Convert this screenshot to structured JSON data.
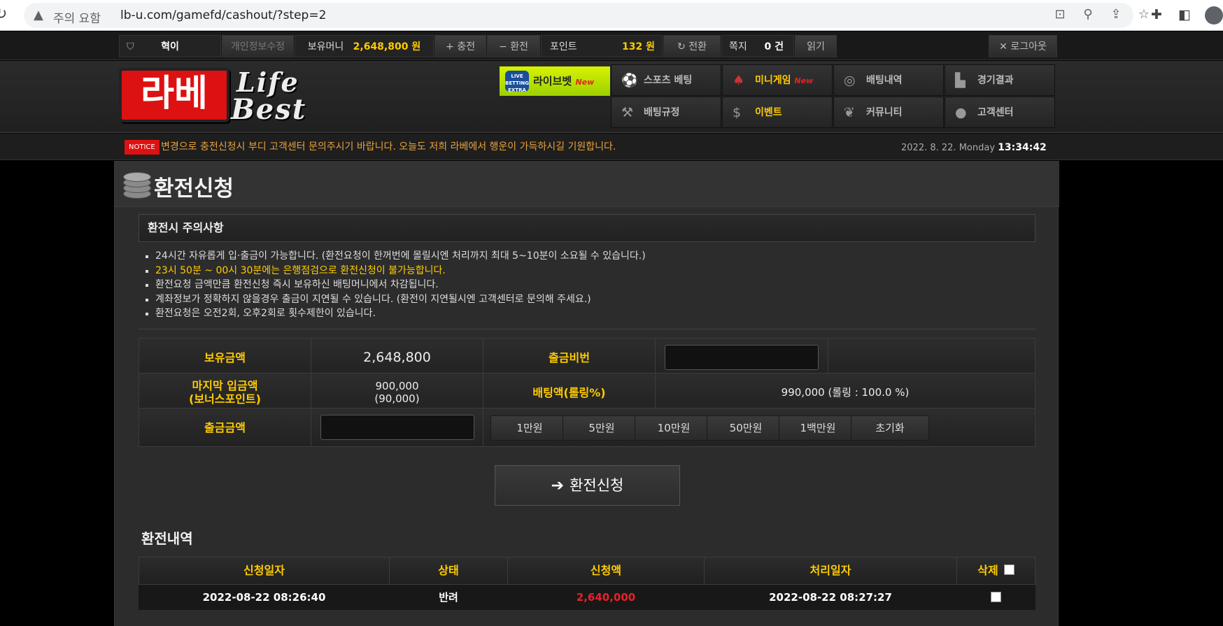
{
  "browser": {
    "security_label": "주의 요함",
    "url": "lb-u.com/gamefd/cashout/?step=2"
  },
  "userbar": {
    "username": "혁이",
    "edit_profile": "개인정보수정",
    "money_label": "보유머니",
    "money_value": "2,648,800 원",
    "charge": "+ 충전",
    "exchange": "− 환전",
    "point_label": "포인트",
    "point_value": "132 원",
    "convert": "↻ 전환",
    "memo_label": "쪽지",
    "memo_value": "0 건",
    "read": "읽기",
    "logout": "✕ 로그아웃"
  },
  "header": {
    "logo_kr": "라베",
    "logo_en_1": "Life",
    "logo_en_2": "Best",
    "live_badge": "LIVE BETTING EXTRA",
    "live_label": "라이브벳",
    "live_new": "New",
    "nav": [
      {
        "label": "스포츠 베팅",
        "icon": "soccer-ball-icon"
      },
      {
        "label": "미니게임",
        "icon": "cards-icon",
        "new": "New"
      },
      {
        "label": "배팅내역",
        "icon": "target-icon"
      },
      {
        "label": "경기결과",
        "icon": "podium-icon"
      },
      {
        "label": "배팅규정",
        "icon": "gavel-icon"
      },
      {
        "label": "이벤트",
        "icon": "money-bag-icon"
      },
      {
        "label": "커뮤니티",
        "icon": "community-icon"
      },
      {
        "label": "고객센터",
        "icon": "apple-icon"
      }
    ]
  },
  "notice": {
    "tag": "NOTICE",
    "text": "변경으로 충전신청시 부디 고객센터 문의주시기 바랍니다. 오늘도 저희 라베에서 행운이 가득하시길 기원합니다.",
    "date": "2022. 8. 22. Monday",
    "time": "13:34:42"
  },
  "page": {
    "title": "환전신청",
    "caution_title": "환전시 주의사항",
    "cautions": [
      "24시간 자유롭게 입·출금이 가능합니다. (환전요청이 한꺼번에 몰릴시엔 처리까지 최대 5~10분이 소요될 수 있습니다.)",
      "23시 50분 ~ 00시 30분에는 은행점검으로 환전신청이 불가능합니다.",
      "환전요청 금액만큼 환전신청 즉시 보유하신 배팅머니에서 차감됩니다.",
      "계좌정보가 정확하지 않을경우 출금이 지연될 수 있습니다. (환전이 지연될시엔 고객센터로 문의해 주세요.)",
      "환전요청은 오전2회, 오후2회로 횟수제한이 있습니다."
    ]
  },
  "form": {
    "balance_label": "보유금액",
    "balance_value": "2,648,800",
    "password_label": "출금비번",
    "last_deposit_label_1": "마지막 입금액",
    "last_deposit_label_2": "(보너스포인트)",
    "last_deposit_value": "900,000",
    "last_deposit_bonus": "(90,000)",
    "betting_label": "배팅액(롤링%)",
    "betting_value": "990,000 (롤링 : 100.0 %)",
    "amount_label": "출금금액",
    "amount_buttons": [
      "1만원",
      "5만원",
      "10만원",
      "50만원",
      "1백만원",
      "초기화"
    ],
    "submit": "환전신청"
  },
  "history": {
    "title": "환전내역",
    "columns": [
      "신청일자",
      "상태",
      "신청액",
      "처리일자",
      "삭제"
    ],
    "rows": [
      {
        "date": "2022-08-22 08:26:40",
        "status": "반려",
        "amount": "2,640,000",
        "processed": "2022-08-22 08:27:27"
      }
    ]
  }
}
